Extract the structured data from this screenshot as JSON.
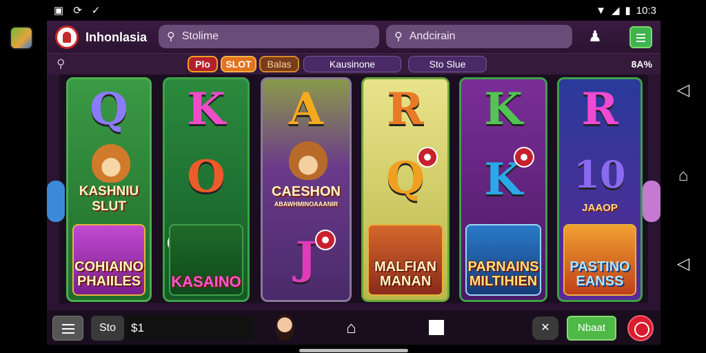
{
  "status_bar": {
    "left_icons": [
      "screenshot-icon",
      "sync-icon",
      "check-icon"
    ],
    "time": "10:3",
    "right_icons": [
      "wifi-icon",
      "signal-icon",
      "battery-icon"
    ]
  },
  "header": {
    "brand": "Inhonlasia",
    "search1_text": "Stolime",
    "search2_text": "Andcirain"
  },
  "filter_bar": {
    "pills": [
      "Plo",
      "SLOT",
      "Balas",
      "Kausinone",
      "Sto Slue"
    ],
    "percent": "8A%"
  },
  "reels": [
    {
      "top": "Q",
      "top_color": "#7a6df0",
      "mid_caption": "KASHNIU SLUT",
      "tile": "COHIAINO PHAIILES",
      "bg": "#2f8a3a",
      "tile_bg": "#8a2a9e"
    },
    {
      "top": "K",
      "top_color": "#e24ac0",
      "mid": "O",
      "mid_color": "#e8542e",
      "tile": "KASAINO",
      "bg": "#1e7a3a",
      "tile_bg": "#1b5e2a"
    },
    {
      "top": "A",
      "top_color": "#f0a020",
      "mid_caption": "CAESHON",
      "mid_sub": "ABAWHMINOAAANIR",
      "tile_sym": "J",
      "tile_color": "#e03bb8",
      "bg": "#7a4a9a",
      "tile_bg": "#5a2a7a"
    },
    {
      "top": "R",
      "top_color": "#e8742a",
      "mid": "Q",
      "mid_color": "#f0a020",
      "tile": "MALFIAN MANAN",
      "bg": "#d7d26a",
      "tile_bg": "#b8482a"
    },
    {
      "top": "K",
      "top_color": "#4fc04f",
      "mid": "K",
      "mid_color": "#2aa0e0",
      "tile": "PARNAINS MILTIHIEN",
      "bg": "#6a2a86",
      "tile_bg": "#1e4a8a"
    },
    {
      "top": "R",
      "top_color": "#e94acb",
      "mid": "10",
      "mid_color": "#7a5ae8",
      "mid_label": "JAAOP",
      "tile": "PASTINO EANSS",
      "bg": "#3a2a8a",
      "tile_bg": "#e07a2a"
    }
  ],
  "bottom_bar": {
    "sto": "Sto",
    "bet": "$1",
    "next": "Nbaat",
    "close": "✕"
  },
  "colors": {
    "accent_green": "#4fb948",
    "accent_red": "#d81c2e",
    "app_bg": "#2a1431"
  }
}
